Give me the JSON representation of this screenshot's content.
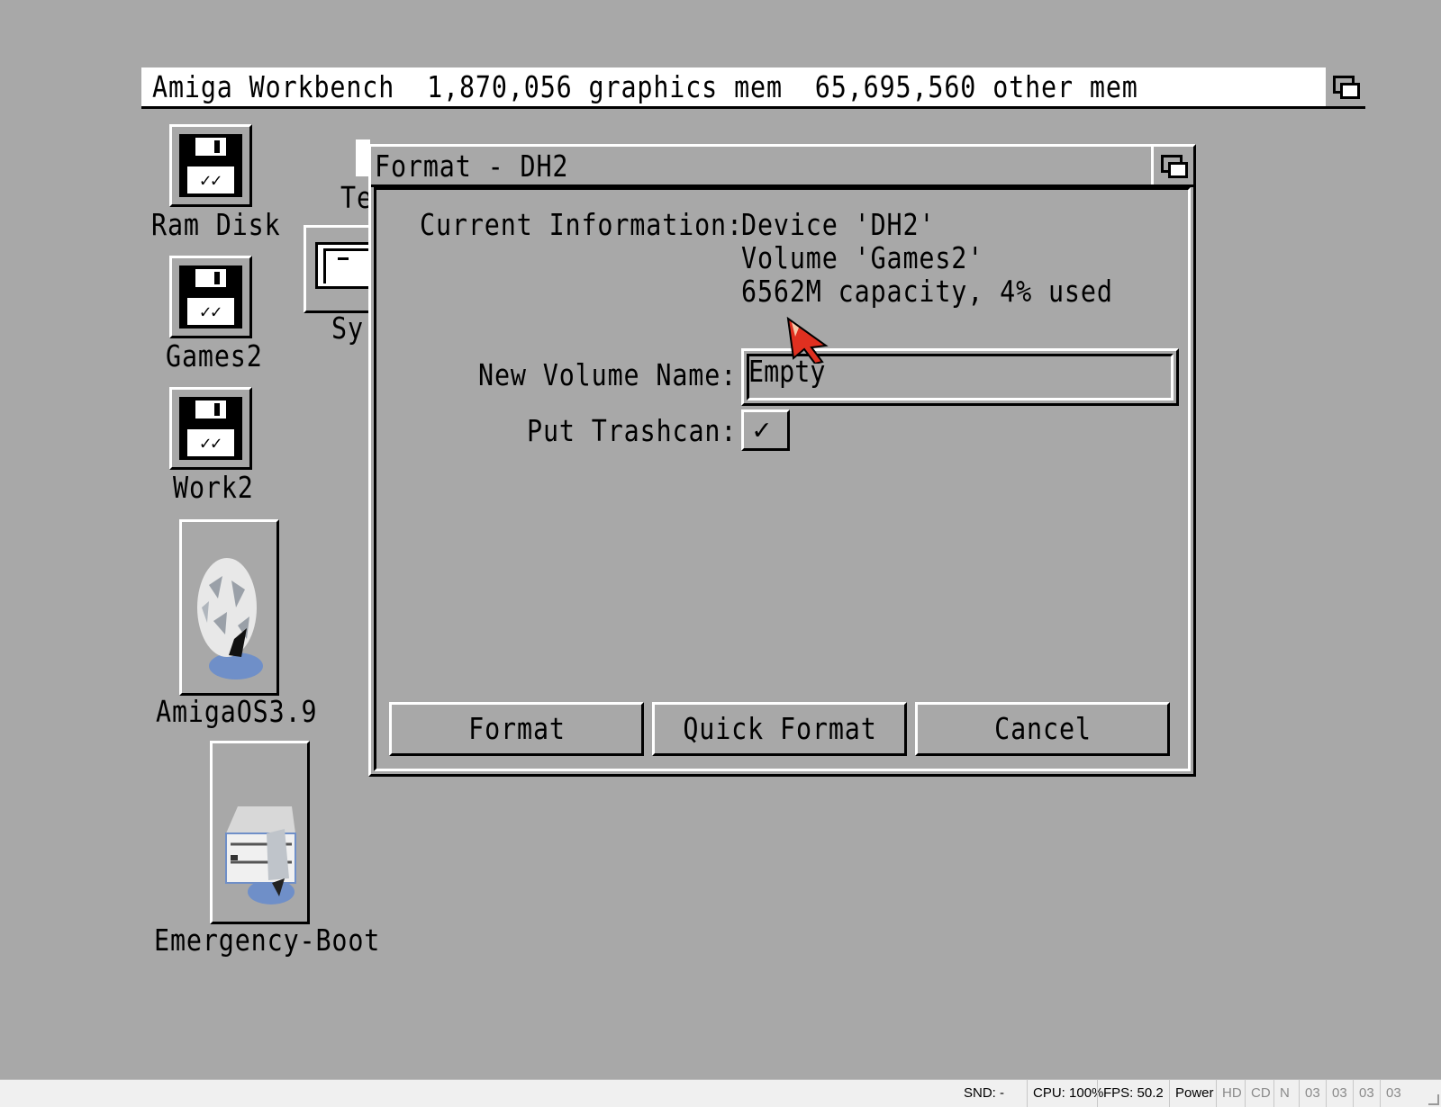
{
  "screen": {
    "title": "Amiga Workbench  1,870,056 graphics mem  65,695,560 other mem"
  },
  "desktop_icons": [
    {
      "label": "Ram Disk",
      "icon": "floppy-disk-icon"
    },
    {
      "label": "Games2",
      "icon": "floppy-disk-icon"
    },
    {
      "label": "Work2",
      "icon": "floppy-disk-icon"
    },
    {
      "label": "AmigaOS3.9",
      "icon": "amigaos-balloon-icon"
    },
    {
      "label": "Emergency-Boot",
      "icon": "emergency-boot-drive-icon"
    }
  ],
  "partial_icons": [
    {
      "label": "Te"
    },
    {
      "label": "Sy"
    }
  ],
  "dialog": {
    "title": "Format - DH2",
    "current_info_label": "Current Information:",
    "info_lines": [
      "Device 'DH2'",
      "Volume 'Games2'",
      "6562M capacity, 4% used"
    ],
    "new_volume_label": "New Volume Name:",
    "new_volume_value": "Empty",
    "trashcan_label": "Put Trashcan:",
    "trashcan_checked": "✓",
    "buttons": {
      "format": "Format",
      "quick_format": "Quick Format",
      "cancel": "Cancel"
    }
  },
  "statusbar": {
    "snd": "SND: -",
    "cpu": "CPU: 100%",
    "fps": "FPS: 50.2",
    "power": "Power",
    "hd": "HD",
    "cd": "CD",
    "n": "N",
    "drives": [
      "03",
      "03",
      "03",
      "03"
    ]
  },
  "colors": {
    "workbench_gray": "#a8a8a8",
    "highlight": "#ffffff",
    "shadow": "#000000",
    "pointer": "#e03020"
  }
}
